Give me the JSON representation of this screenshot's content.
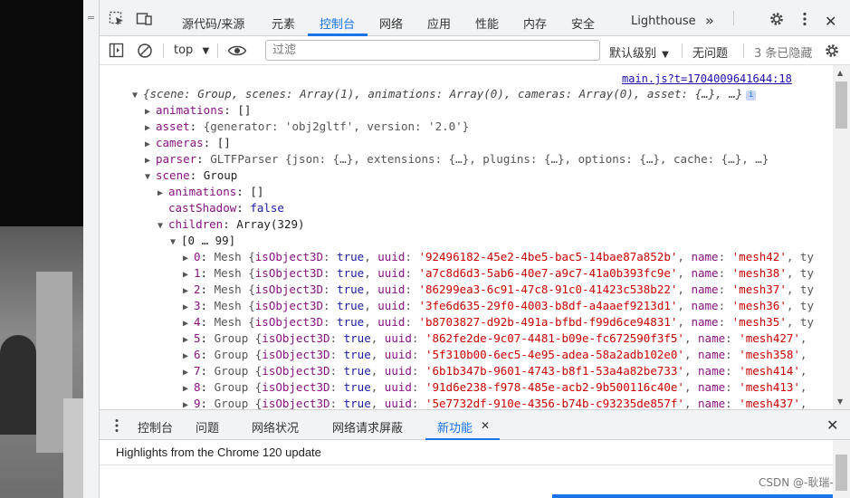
{
  "top_tabs": {
    "inspect_icon": "element-picker-icon",
    "device_icon": "device-toolbar-icon",
    "items": [
      "源代码/来源",
      "元素",
      "控制台",
      "网络",
      "应用",
      "性能",
      "内存",
      "安全",
      "Lighthouse"
    ],
    "active": "控制台",
    "more": "»",
    "settings_icon": "gear-icon",
    "menu_icon": "kebab-menu-icon",
    "close": "✕"
  },
  "console_toolbar": {
    "context": "top",
    "filter_placeholder": "过滤",
    "levels": "默认级别",
    "issues": "无问题",
    "hidden": "3 条已隐藏"
  },
  "output": {
    "source_link": "main.js?t=1704009641644:18",
    "root_summary": "{scene: Group, scenes: Array(1), animations: Array(0), cameras: Array(0), asset: {…}, …}",
    "rows": [
      {
        "key": "animations",
        "value": "[]"
      },
      {
        "key": "asset",
        "value": "{generator: 'obj2gltf', version: '2.0'}"
      },
      {
        "key": "cameras",
        "value": "[]"
      },
      {
        "key": "parser",
        "value": "GLTFParser {json: {…}, extensions: {…}, plugins: {…}, options: {…}, cache: {…}, …}"
      },
      {
        "key": "scene",
        "value": "Group"
      },
      {
        "key": "animations",
        "value": "[]"
      },
      {
        "key": "castShadow",
        "value": "false"
      },
      {
        "key": "children",
        "value": "Array(329)"
      },
      {
        "key": "range",
        "value": "[0 … 99]"
      }
    ],
    "children": [
      {
        "index": "0",
        "type": "Mesh",
        "uuid": "'92496182-45e2-4be5-bac5-14bae87a852b'",
        "name": "'mesh42'",
        "tail": ", ty"
      },
      {
        "index": "1",
        "type": "Mesh",
        "uuid": "'a7c8d6d3-5ab6-40e7-a9c7-41a0b393fc9e'",
        "name": "'mesh38'",
        "tail": ", ty"
      },
      {
        "index": "2",
        "type": "Mesh",
        "uuid": "'86299ea3-6c91-47c8-91c0-41423c538b22'",
        "name": "'mesh37'",
        "tail": ", ty"
      },
      {
        "index": "3",
        "type": "Mesh",
        "uuid": "'3fe6d635-29f0-4003-b8df-a4aaef9213d1'",
        "name": "'mesh36'",
        "tail": ", ty"
      },
      {
        "index": "4",
        "type": "Mesh",
        "uuid": "'b8703827-d92b-491a-bfbd-f99d6ce94831'",
        "name": "'mesh35'",
        "tail": ", ty"
      },
      {
        "index": "5",
        "type": "Group",
        "uuid": "'862fe2de-9c07-4481-b09e-fc672590f3f5'",
        "name": "'mesh427'",
        "tail": ","
      },
      {
        "index": "6",
        "type": "Group",
        "uuid": "'5f310b00-6ec5-4e95-adea-58a2adb102e0'",
        "name": "'mesh358'",
        "tail": ","
      },
      {
        "index": "7",
        "type": "Group",
        "uuid": "'6b1b347b-9601-4743-b8f1-53a4a82be733'",
        "name": "'mesh414'",
        "tail": ","
      },
      {
        "index": "8",
        "type": "Group",
        "uuid": "'91d6e238-f978-485e-acb2-9b500116c40e'",
        "name": "'mesh413'",
        "tail": ","
      },
      {
        "index": "9",
        "type": "Group",
        "uuid": "'5e7732df-910e-4356-b74b-c93235de857f'",
        "name": "'mesh437'",
        "tail": ","
      }
    ]
  },
  "drawer": {
    "tabs": [
      "控制台",
      "问题",
      "网络状况",
      "网络请求屏蔽",
      "新功能"
    ],
    "active": "新功能",
    "highlights": "Highlights from the Chrome 120 update",
    "close": "✕"
  },
  "watermark": "CSDN @-耿瑞-"
}
